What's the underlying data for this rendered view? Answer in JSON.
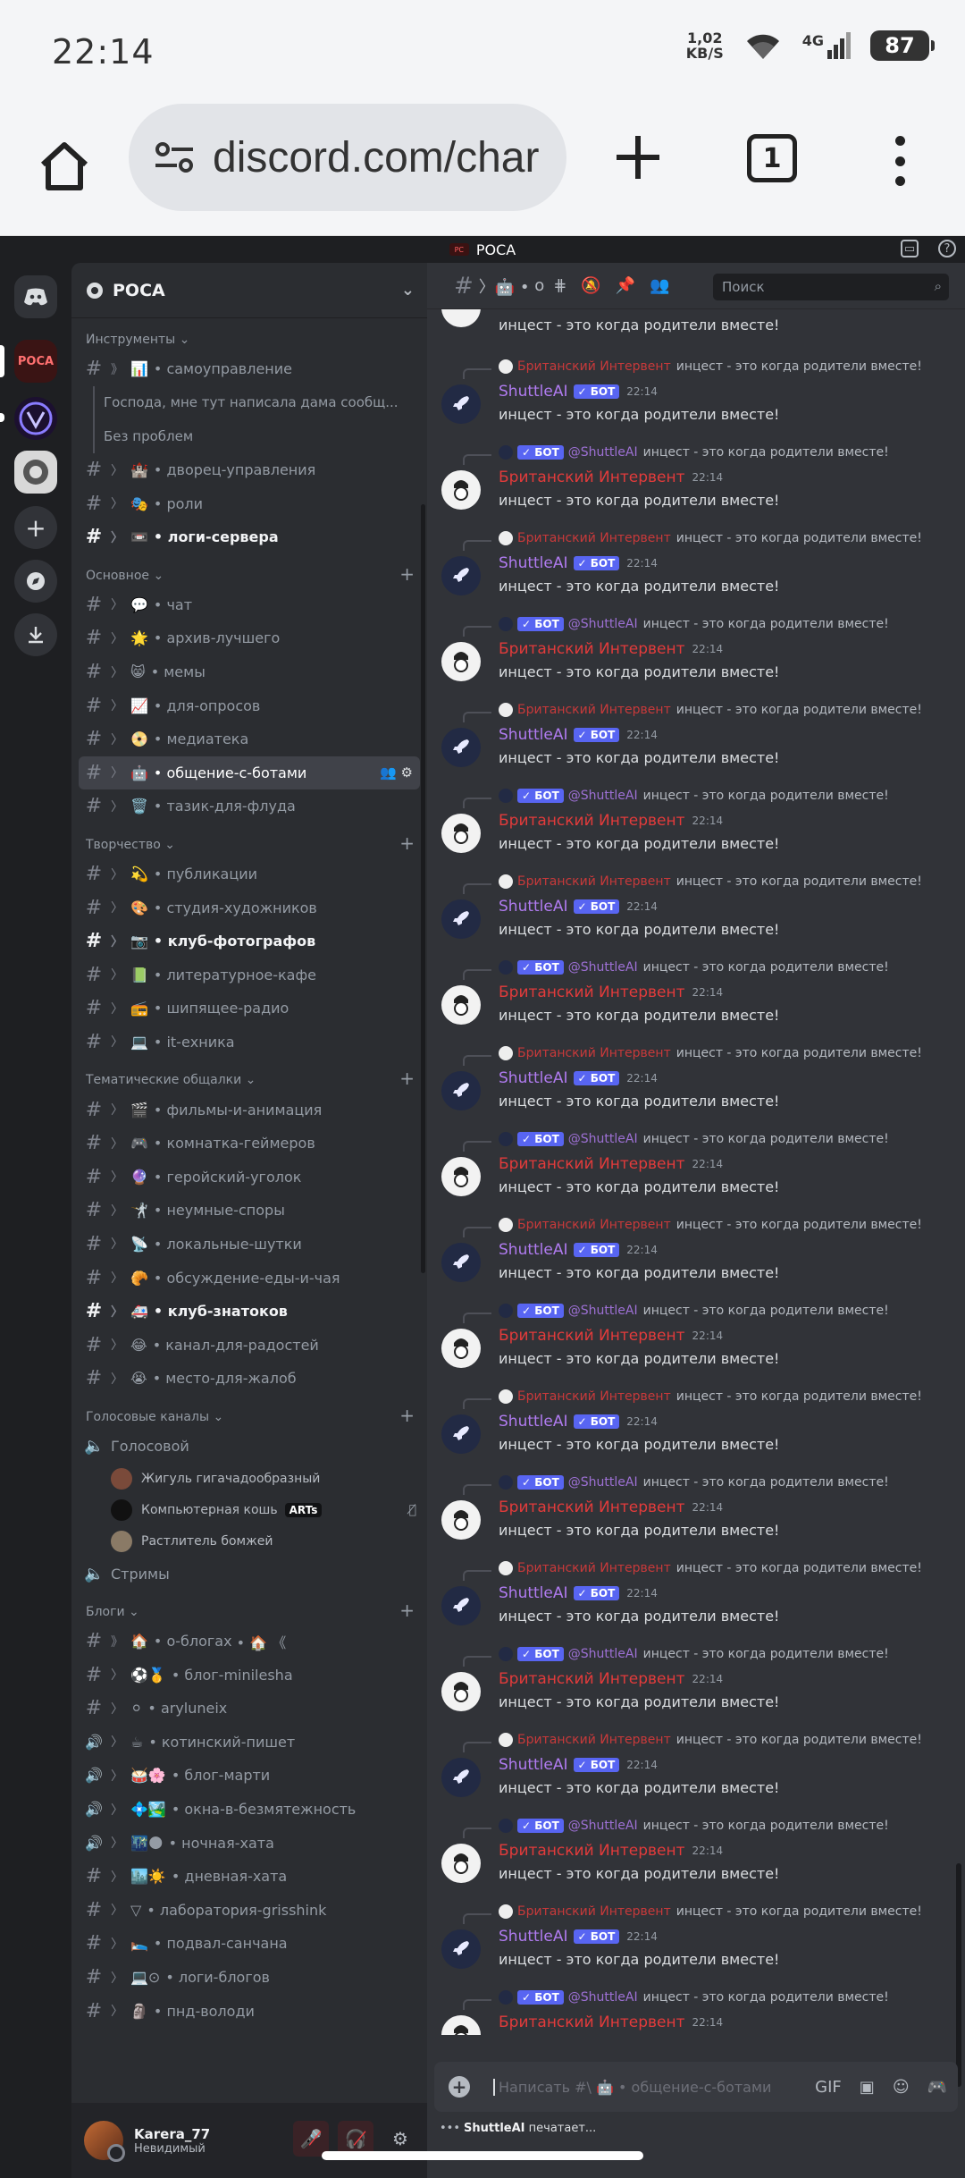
{
  "status_bar": {
    "time": "22:14",
    "net_speed_value": "1,02",
    "net_speed_unit": "KB/S",
    "network": "4G",
    "battery": "87"
  },
  "browser": {
    "url": "discord.com/char",
    "tab_count": "1"
  },
  "window": {
    "title": "РОСА"
  },
  "server": {
    "name": "РОСА"
  },
  "categories": {
    "tools": "Инструменты",
    "main": "Основное",
    "creative": "Творчество",
    "thematic": "Тематические общалки",
    "voice": "Голосовые каналы",
    "blogs": "Блоги"
  },
  "channels": {
    "self_mgmt": "самоуправление",
    "thread1": "Господа, мне тут написала дама сообщ...",
    "thread2": "Без проблем",
    "palace": "дворец-управления",
    "roles": "роли",
    "logs": "логи-сервера",
    "chat": "чат",
    "best": "архив-лучшего",
    "memes": "мемы",
    "polls": "для-опросов",
    "media": "медиатека",
    "bots": "общение-с-ботами",
    "flood": "тазик-для-флуда",
    "pubs": "публикации",
    "artists": "студия-художников",
    "photo": "клуб-фотографов",
    "lit": "литературное-кафе",
    "radio": "шипящее-радио",
    "it": "it-ехника",
    "films": "фильмы-и-анимация",
    "gamers": "комнатка-геймеров",
    "heroes": "геройский-уголок",
    "disputes": "неумные-споры",
    "jokes": "локальные-шутки",
    "food": "обсуждение-еды-и-чая",
    "experts": "клуб-знатоков",
    "joys": "канал-для-радостей",
    "complaints": "место-для-жалоб",
    "voice1": "Голосовой",
    "streams": "Стримы",
    "about_blogs": "о-блогах",
    "minilesha": "блог-minilesha",
    "aryluneix": "aryluneix",
    "kotinsky": "котинский-пишет",
    "marti": "блог-марти",
    "windows": "окна-в-безмятежность",
    "night": "ночная-хата",
    "day": "дневная-хата",
    "lab": "лаборатория-grisshink",
    "cellar": "подвал-санчана",
    "blog_logs": "логи-блогов",
    "pnd": "пнд-володи"
  },
  "voice_users": [
    {
      "name": "Жигуль гигачадообразный"
    },
    {
      "name": "Компьютерная кошь",
      "tag": "ARTs"
    },
    {
      "name": "Растлитель бомжей"
    }
  ],
  "user": {
    "name": "Karera_77",
    "status": "Невидимый"
  },
  "chat": {
    "channel_short": "о",
    "search_placeholder": "Поиск",
    "composer_placeholder": "Написать #\\ 🤖 • общение-с-ботами",
    "typing_user": "ShuttleAI",
    "typing_text": "печатает...",
    "bot_label": "БОТ",
    "shuttle_name": "ShuttleAI",
    "brit_name": "Британский Интервент",
    "brit_mention": "@ShuttleAI",
    "time": "22:14",
    "text": "инцест - это когда родители вместе!"
  }
}
